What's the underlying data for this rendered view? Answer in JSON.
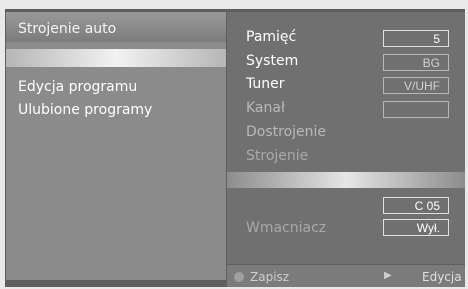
{
  "left_menu": {
    "items": [
      {
        "label": "Strojenie auto"
      },
      {
        "label": "Edycja programu"
      },
      {
        "label": "Ulubione programy"
      }
    ]
  },
  "right_panel": {
    "rows": [
      {
        "label": "Pamięć",
        "value": "5"
      },
      {
        "label": "System",
        "value": "BG"
      },
      {
        "label": "Tuner",
        "value": "V/UHF"
      },
      {
        "label": "Kanał",
        "value": ""
      },
      {
        "label": "Dostrojenie"
      },
      {
        "label": "Strojenie"
      }
    ],
    "channel_value": "C 05",
    "amplifier_label": "Wmacniacz",
    "amplifier_value": "Wył."
  },
  "footer": {
    "left_text": "Zapisz",
    "right_text": "Edycja"
  }
}
